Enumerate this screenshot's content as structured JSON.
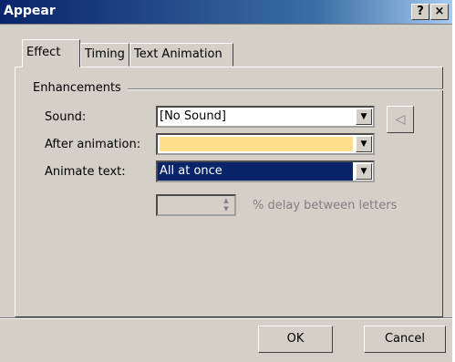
{
  "window": {
    "title": "Appear",
    "help_label": "?",
    "close_label": "×"
  },
  "tabs": [
    {
      "label": "Effect"
    },
    {
      "label": "Timing"
    },
    {
      "label": "Text Animation"
    }
  ],
  "enhancements": {
    "group_label": "Enhancements",
    "sound_label": "Sound:",
    "sound_value": "[No Sound]",
    "after_label": "After animation:",
    "after_value": "",
    "after_color": "#ffe08a",
    "animate_label": "Animate text:",
    "animate_value": "All at once",
    "delay_value": "",
    "delay_label": "% delay between letters"
  },
  "footer": {
    "ok_label": "OK",
    "cancel_label": "Cancel"
  }
}
